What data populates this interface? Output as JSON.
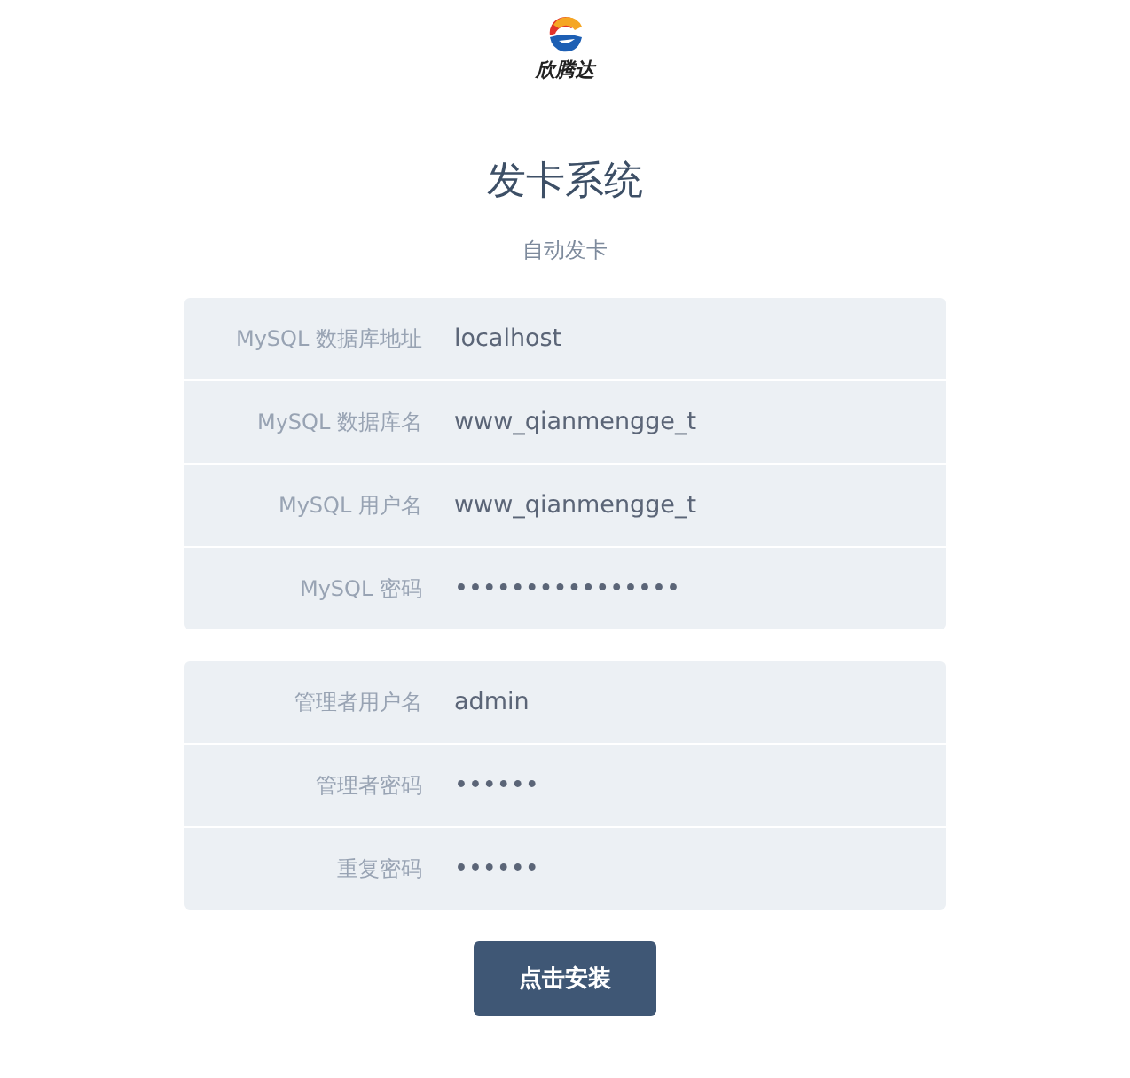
{
  "logo": {
    "text": "欣腾达"
  },
  "title": "发卡系统",
  "subtitle": "自动发卡",
  "groups": [
    {
      "fields": [
        {
          "label": "MySQL 数据库地址",
          "value": "localhost"
        },
        {
          "label": "MySQL 数据库名",
          "value": "www_qianmengge_t"
        },
        {
          "label": "MySQL 用户名",
          "value": "www_qianmengge_t"
        },
        {
          "label": "MySQL 密码",
          "value": "••••••••••••••••"
        }
      ]
    },
    {
      "fields": [
        {
          "label": "管理者用户名",
          "value": "admin"
        },
        {
          "label": "管理者密码",
          "value": "••••••"
        },
        {
          "label": "重复密码",
          "value": "••••••"
        }
      ]
    }
  ],
  "button": "点击安装"
}
